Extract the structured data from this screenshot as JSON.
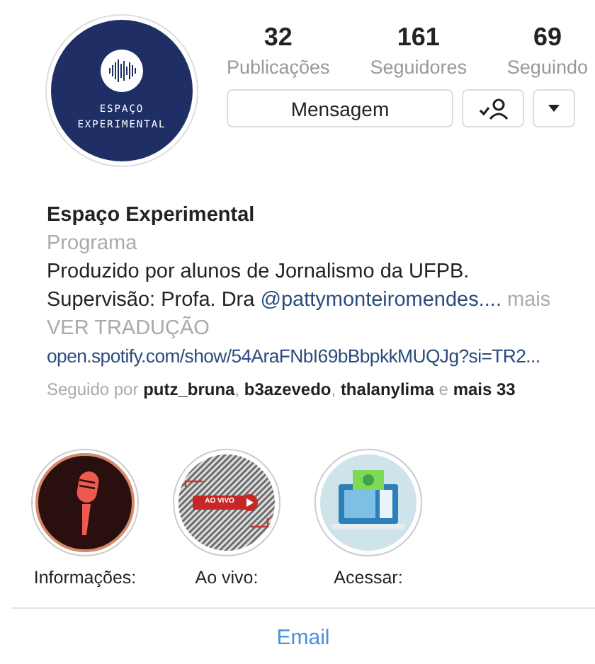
{
  "profile": {
    "logo_text": [
      "ESPAÇO",
      "EXPERIMENTAL"
    ],
    "stats": [
      {
        "value": "32",
        "label": "Publicações"
      },
      {
        "value": "161",
        "label": "Seguidores"
      },
      {
        "value": "69",
        "label": "Seguindo"
      }
    ],
    "message_button": "Mensagem"
  },
  "bio": {
    "name": "Espaço Experimental",
    "category": "Programa",
    "description": "Produzido por alunos de Jornalismo da UFPB.",
    "supervision": {
      "text": "Supervisão: Profa. Dra ",
      "mention": "@pattymonteiromendes....",
      "more": "mais"
    },
    "translate": "VER TRADUÇÃO",
    "link": "open.spotify.com/show/54AraFNbI69bBbpkkMUQJg?si=TR2...",
    "followed_by": "Seguido por **putz_bruna**, **b3azevedo**, **thalanylima** e **mais 33**"
  },
  "highlights": [
    {
      "kind": "microphone",
      "label": "Informações:"
    },
    {
      "kind": "live",
      "label": "Ao vivo:",
      "badge": "AO VIVO"
    },
    {
      "kind": "computer",
      "label": "Acessar:"
    }
  ],
  "contact_button": "Email"
}
